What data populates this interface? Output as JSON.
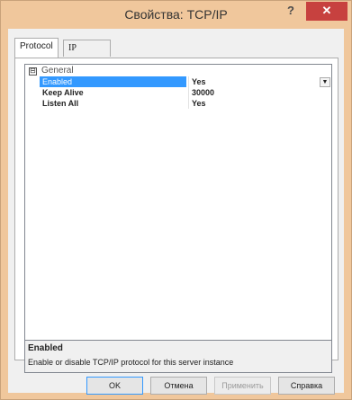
{
  "window": {
    "title": "Свойства: TCP/IP",
    "help_label": "?",
    "close_label": "✕"
  },
  "tabs": [
    {
      "label": "Protocol",
      "active": true
    },
    {
      "label": "IP Addresses",
      "active": false
    }
  ],
  "grid": {
    "category": {
      "expander": "⊟",
      "label": "General"
    },
    "properties": [
      {
        "name": "Enabled",
        "value": "Yes",
        "selected": true
      },
      {
        "name": "Keep Alive",
        "value": "30000",
        "selected": false
      },
      {
        "name": "Listen All",
        "value": "Yes",
        "selected": false
      }
    ],
    "dropdown_icon": "▼"
  },
  "description": {
    "title": "Enabled",
    "text": "Enable or disable TCP/IP protocol for this server instance"
  },
  "buttons": {
    "ok": "OK",
    "cancel": "Отмена",
    "apply": "Применить",
    "help": "Справка"
  },
  "colors": {
    "title_bar": "#f0c79c",
    "close_button": "#c7413f",
    "selection": "#3399ff"
  }
}
